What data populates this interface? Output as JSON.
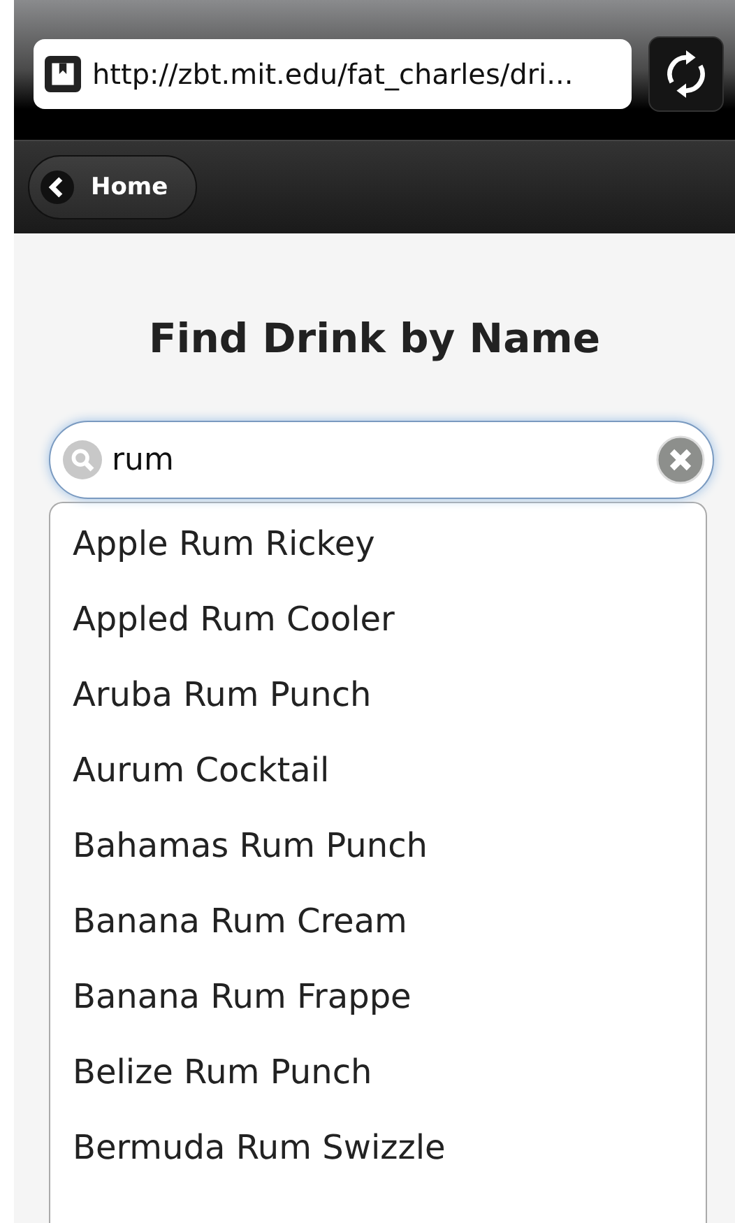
{
  "browser": {
    "url": "http://zbt.mit.edu/fat_charles/dri..."
  },
  "header": {
    "back_button": "Home"
  },
  "page": {
    "title": "Find Drink by Name"
  },
  "search": {
    "value": "rum"
  },
  "suggestions": [
    {
      "label": "Apple Rum Rickey"
    },
    {
      "label": "Appled Rum Cooler"
    },
    {
      "label": "Aruba Rum Punch"
    },
    {
      "label": "Aurum Cocktail"
    },
    {
      "label": "Bahamas Rum Punch"
    },
    {
      "label": "Banana Rum Cream"
    },
    {
      "label": "Banana Rum Frappe"
    },
    {
      "label": "Belize Rum Punch"
    },
    {
      "label": "Bermuda Rum Swizzle"
    }
  ]
}
